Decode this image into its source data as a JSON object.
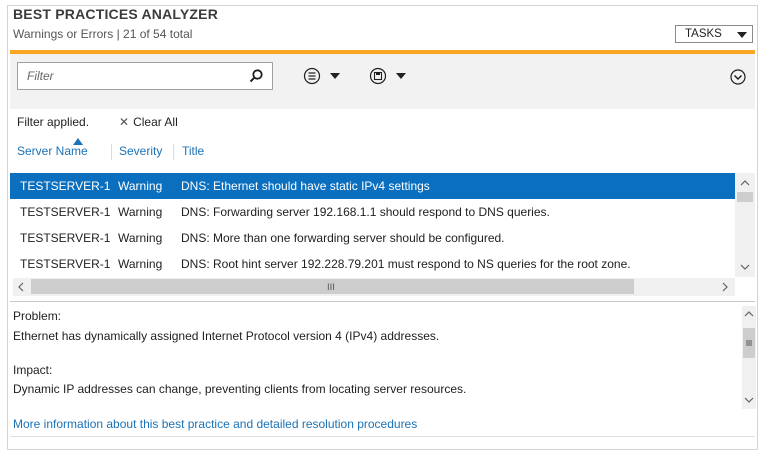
{
  "header": {
    "title": "BEST PRACTICES ANALYZER",
    "subtitle": "Warnings or Errors | 21 of 54 total",
    "tasks_label": "TASKS"
  },
  "accent_color": "#f8a623",
  "selection_color": "#0b6fbf",
  "link_color": "#1a73b8",
  "toolbar": {
    "filter_placeholder": "Filter",
    "icons": [
      "search-icon",
      "list-options-icon",
      "save-query-icon",
      "expand-icon"
    ]
  },
  "filter_status": {
    "applied_text": "Filter applied.",
    "clear_all_label": "Clear All",
    "clear_glyph": "✕"
  },
  "columns": [
    "Server Name",
    "Severity",
    "Title"
  ],
  "rows": [
    {
      "server": "TESTSERVER-1",
      "severity": "Warning",
      "title": "DNS: Ethernet should have static IPv4 settings",
      "selected": true
    },
    {
      "server": "TESTSERVER-1",
      "severity": "Warning",
      "title": "DNS: Forwarding server 192.168.1.1 should respond to DNS queries.",
      "selected": false
    },
    {
      "server": "TESTSERVER-1",
      "severity": "Warning",
      "title": "DNS: More than one forwarding server should be configured.",
      "selected": false
    },
    {
      "server": "TESTSERVER-1",
      "severity": "Warning",
      "title": "DNS: Root hint server 192.228.79.201 must respond to NS queries for the root zone.",
      "selected": false
    }
  ],
  "scrollbar_grip": "III",
  "detail": {
    "problem_label": "Problem:",
    "problem_text": "Ethernet has dynamically assigned Internet Protocol version 4 (IPv4) addresses.",
    "impact_label": "Impact:",
    "impact_text": "Dynamic IP addresses can change, preventing clients from locating server resources."
  },
  "more_info_link": "More information about this best practice and detailed resolution procedures"
}
